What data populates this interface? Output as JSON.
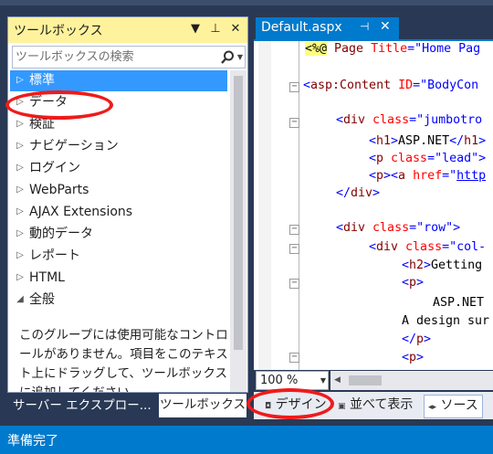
{
  "toolbox": {
    "title": "ツールボックス",
    "dropdown_glyph": "▼",
    "pin_glyph": "⊥",
    "close_glyph": "✕",
    "search_placeholder": "ツールボックスの検索",
    "categories": [
      {
        "label": "標準",
        "expanded": false,
        "selected": true
      },
      {
        "label": "データ",
        "expanded": false,
        "selected": false
      },
      {
        "label": "検証",
        "expanded": false,
        "selected": false
      },
      {
        "label": "ナビゲーション",
        "expanded": false,
        "selected": false
      },
      {
        "label": "ログイン",
        "expanded": false,
        "selected": false
      },
      {
        "label": "WebParts",
        "expanded": false,
        "selected": false
      },
      {
        "label": "AJAX Extensions",
        "expanded": false,
        "selected": false
      },
      {
        "label": "動的データ",
        "expanded": false,
        "selected": false
      },
      {
        "label": "レポート",
        "expanded": false,
        "selected": false
      },
      {
        "label": "HTML",
        "expanded": false,
        "selected": false
      },
      {
        "label": "全般",
        "expanded": true,
        "selected": false
      }
    ],
    "empty_message": "このグループには使用可能なコントロールがありません。項目をこのテキスト上にドラッグして、ツールボックスに追加してください。"
  },
  "bottom_tabs": {
    "server_explorer": "サーバー エクスプロー...",
    "toolbox": "ツールボックス"
  },
  "editor": {
    "tab_label": "Default.aspx",
    "tab_pin_glyph": "⊣",
    "tab_close_glyph": "✕",
    "zoom": "100 %",
    "view_design": "デザイン",
    "view_split": "並べて表示",
    "view_source": "ソース"
  },
  "status": {
    "text": "準備完了"
  },
  "colors": {
    "accent": "#007acc",
    "selection": "#3399ff",
    "toolbox_header": "#fff29d",
    "annotation": "#ef1b1b"
  }
}
